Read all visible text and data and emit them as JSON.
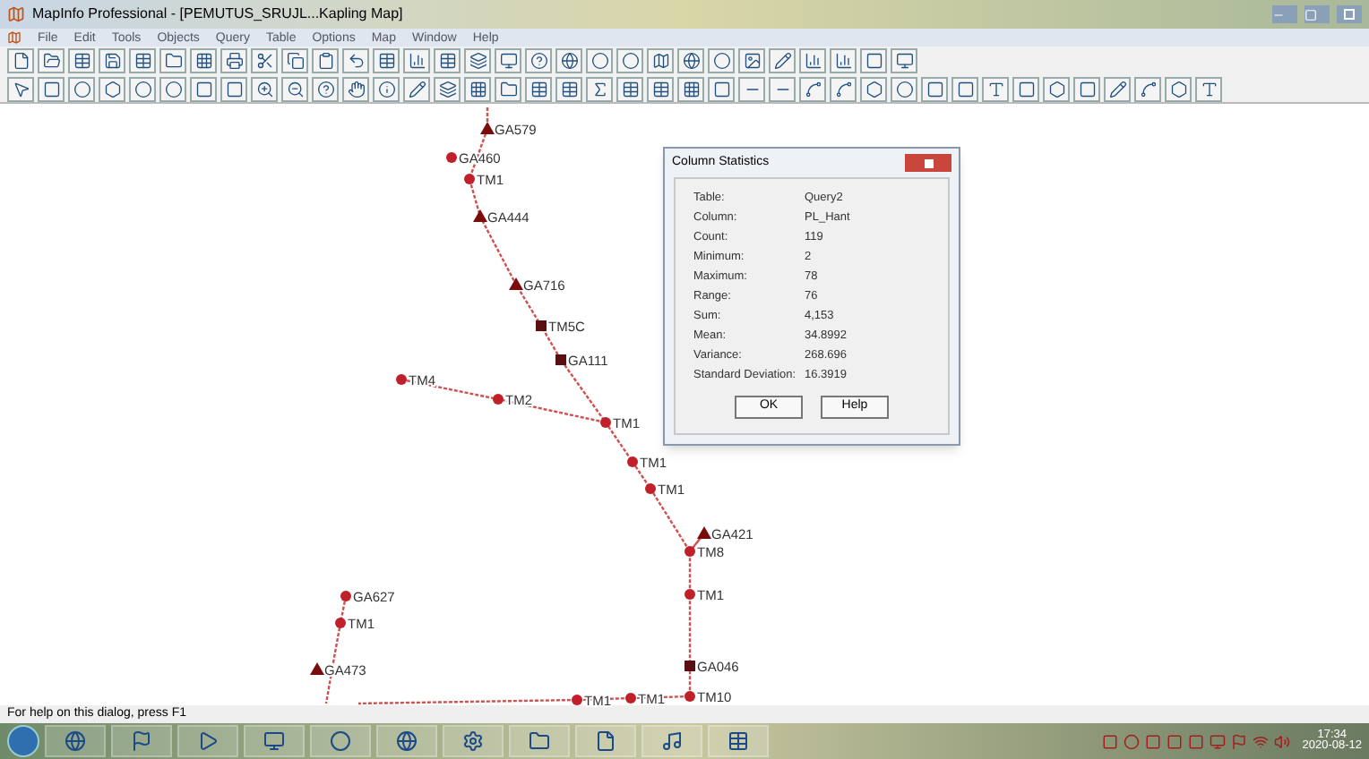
{
  "window": {
    "title": "MapInfo Professional - [PEMUTUS_SRUJL...Kapling Map]"
  },
  "menu": [
    "File",
    "Edit",
    "Tools",
    "Objects",
    "Query",
    "Table",
    "Options",
    "Map",
    "Window",
    "Help"
  ],
  "map": {
    "nodes": [
      {
        "label": "GA579",
        "kind": "triangle"
      },
      {
        "label": "GA460",
        "kind": "dot"
      },
      {
        "label": "TM1",
        "kind": "dot"
      },
      {
        "label": "GA444",
        "kind": "triangle"
      },
      {
        "label": "GA716",
        "kind": "triangle"
      },
      {
        "label": "TM5C",
        "kind": "square"
      },
      {
        "label": "GA111",
        "kind": "square"
      },
      {
        "label": "TM4",
        "kind": "dot"
      },
      {
        "label": "TM2",
        "kind": "dot"
      },
      {
        "label": "TM1",
        "kind": "dot"
      },
      {
        "label": "TM1",
        "kind": "dot"
      },
      {
        "label": "TM1",
        "kind": "dot"
      },
      {
        "label": "GA421",
        "kind": "triangle"
      },
      {
        "label": "TM8",
        "kind": "dot"
      },
      {
        "label": "TM1",
        "kind": "dot"
      },
      {
        "label": "GA627",
        "kind": "dot"
      },
      {
        "label": "TM1",
        "kind": "dot"
      },
      {
        "label": "GA473",
        "kind": "triangle"
      },
      {
        "label": "GA046",
        "kind": "square"
      },
      {
        "label": "TM1",
        "kind": "dot"
      },
      {
        "label": "TM1",
        "kind": "dot"
      },
      {
        "label": "TM10",
        "kind": "dot"
      }
    ]
  },
  "dialog": {
    "title": "Column Statistics",
    "rows": [
      {
        "label": "Table:",
        "value": "Query2"
      },
      {
        "label": "Column:",
        "value": "PL_Hant"
      },
      {
        "label": "Count:",
        "value": "119"
      },
      {
        "label": "Minimum:",
        "value": "2"
      },
      {
        "label": "Maximum:",
        "value": "78"
      },
      {
        "label": "Range:",
        "value": "76"
      },
      {
        "label": "Sum:",
        "value": "4,153"
      },
      {
        "label": "Mean:",
        "value": "34.8992"
      },
      {
        "label": "Variance:",
        "value": "268.696"
      },
      {
        "label": "Standard Deviation:",
        "value": "16.3919"
      }
    ],
    "buttons": [
      "OK",
      "Help"
    ]
  },
  "status_bar": "For help on this dialog, press F1",
  "taskbar": {
    "time": "17:34",
    "date": "2020-08-12"
  }
}
